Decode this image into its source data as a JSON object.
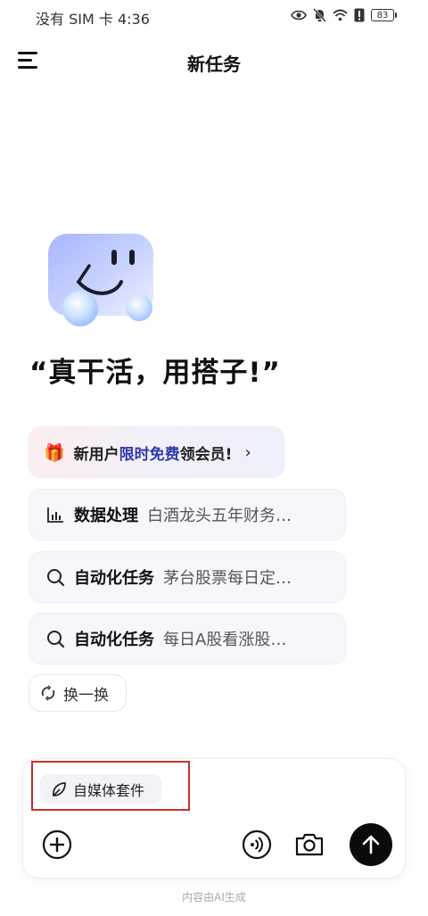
{
  "status_bar": {
    "carrier_time": "没有 SIM 卡 4:36",
    "battery": "83",
    "icons": [
      "eye-icon",
      "bell-muted-icon",
      "wifi-icon",
      "alert-icon",
      "battery-icon"
    ]
  },
  "header": {
    "title": "新任务",
    "menu_icon": "hamburger-menu-icon"
  },
  "tagline": "“真干活，用搭子!”",
  "promo": {
    "prefix": "新用户",
    "highlight": "限时免费",
    "suffix": "领会员!",
    "icon": "gift-icon",
    "chevron": "›",
    "highlight_color": "#2f3aa8"
  },
  "suggestions": [
    {
      "icon": "bar-chart-icon",
      "category": "数据处理",
      "query": "白酒龙头五年财务…"
    },
    {
      "icon": "search-icon",
      "category": "自动化任务",
      "query": "茅台股票每日定…"
    },
    {
      "icon": "search-icon",
      "category": "自动化任务",
      "query": "每日A股看涨股…"
    }
  ],
  "refresh": {
    "label": "换一换",
    "icon": "refresh-icon"
  },
  "composer": {
    "chip_label": "自媒体套件",
    "chip_icon": "leaf-icon",
    "buttons": [
      "plus-icon",
      "voice-icon",
      "camera-icon",
      "send-arrow-icon"
    ],
    "highlight_color": "#c9302c"
  },
  "footnote": "内容由AI生成"
}
